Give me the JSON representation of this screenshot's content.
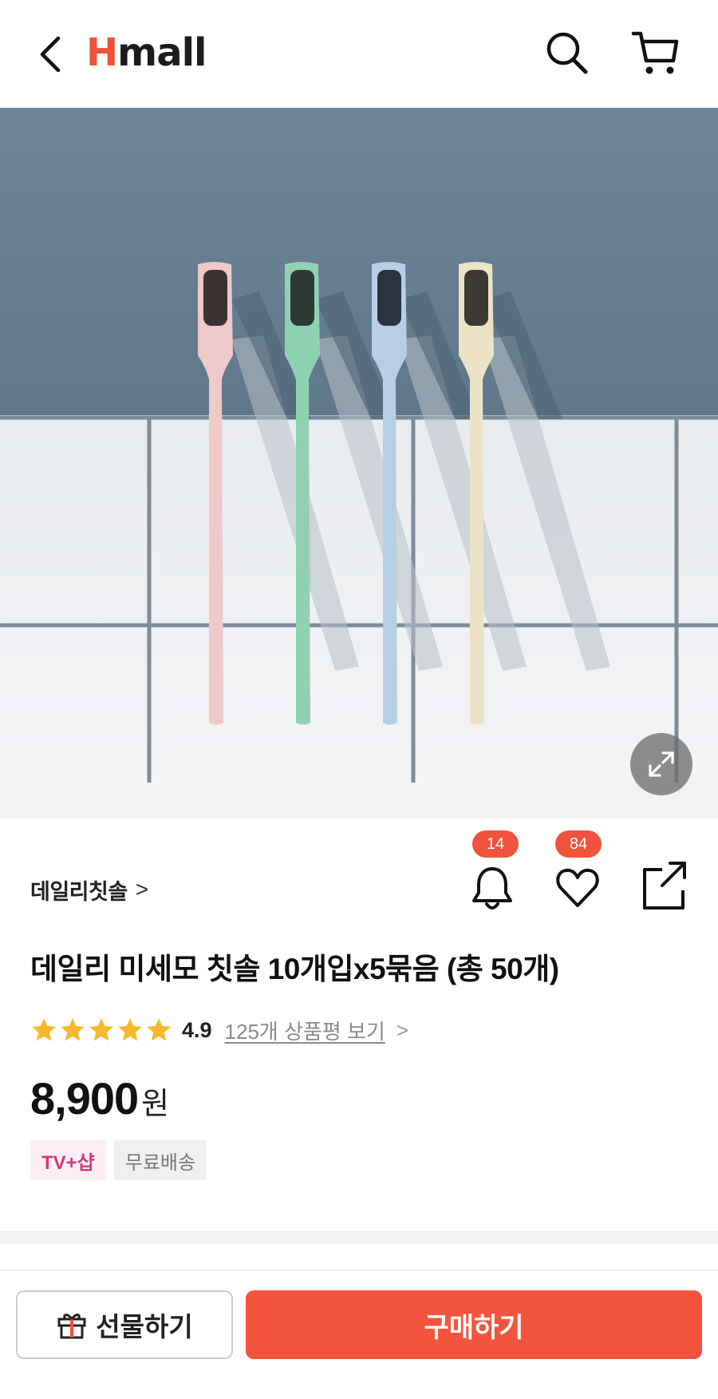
{
  "header": {
    "logo_h": "H",
    "logo_rest": "mall",
    "back_icon": "chevron-left-icon",
    "search_icon": "search-icon",
    "cart_icon": "cart-icon"
  },
  "hero": {
    "image_subject": "four toothbrushes pink green blue beige",
    "expand_icon": "expand-icon"
  },
  "product": {
    "brand": "데일리칫솔",
    "brand_chevron": ">",
    "title": "데일리 미세모 칫솔 10개입x5묶음 (총 50개)",
    "rating": "4.9",
    "rating_stars": 5,
    "review_link": "125개 상품평 보기",
    "review_chevron": ">",
    "price": "8,900",
    "currency": "원",
    "tags": [
      "TV+샵",
      "무료배송"
    ]
  },
  "actions": {
    "notify_count": "14",
    "like_count": "84",
    "notify_icon": "bell-icon",
    "like_icon": "heart-icon",
    "share_icon": "share-icon"
  },
  "bottom": {
    "gift_label": "선물하기",
    "buy_label": "구매하기",
    "gift_icon": "gift-icon"
  },
  "colors": {
    "accent": "#f0523b",
    "buy_button": "#f4543e",
    "star": "#f7b92b",
    "tv_tag_text": "#d23a7a"
  }
}
